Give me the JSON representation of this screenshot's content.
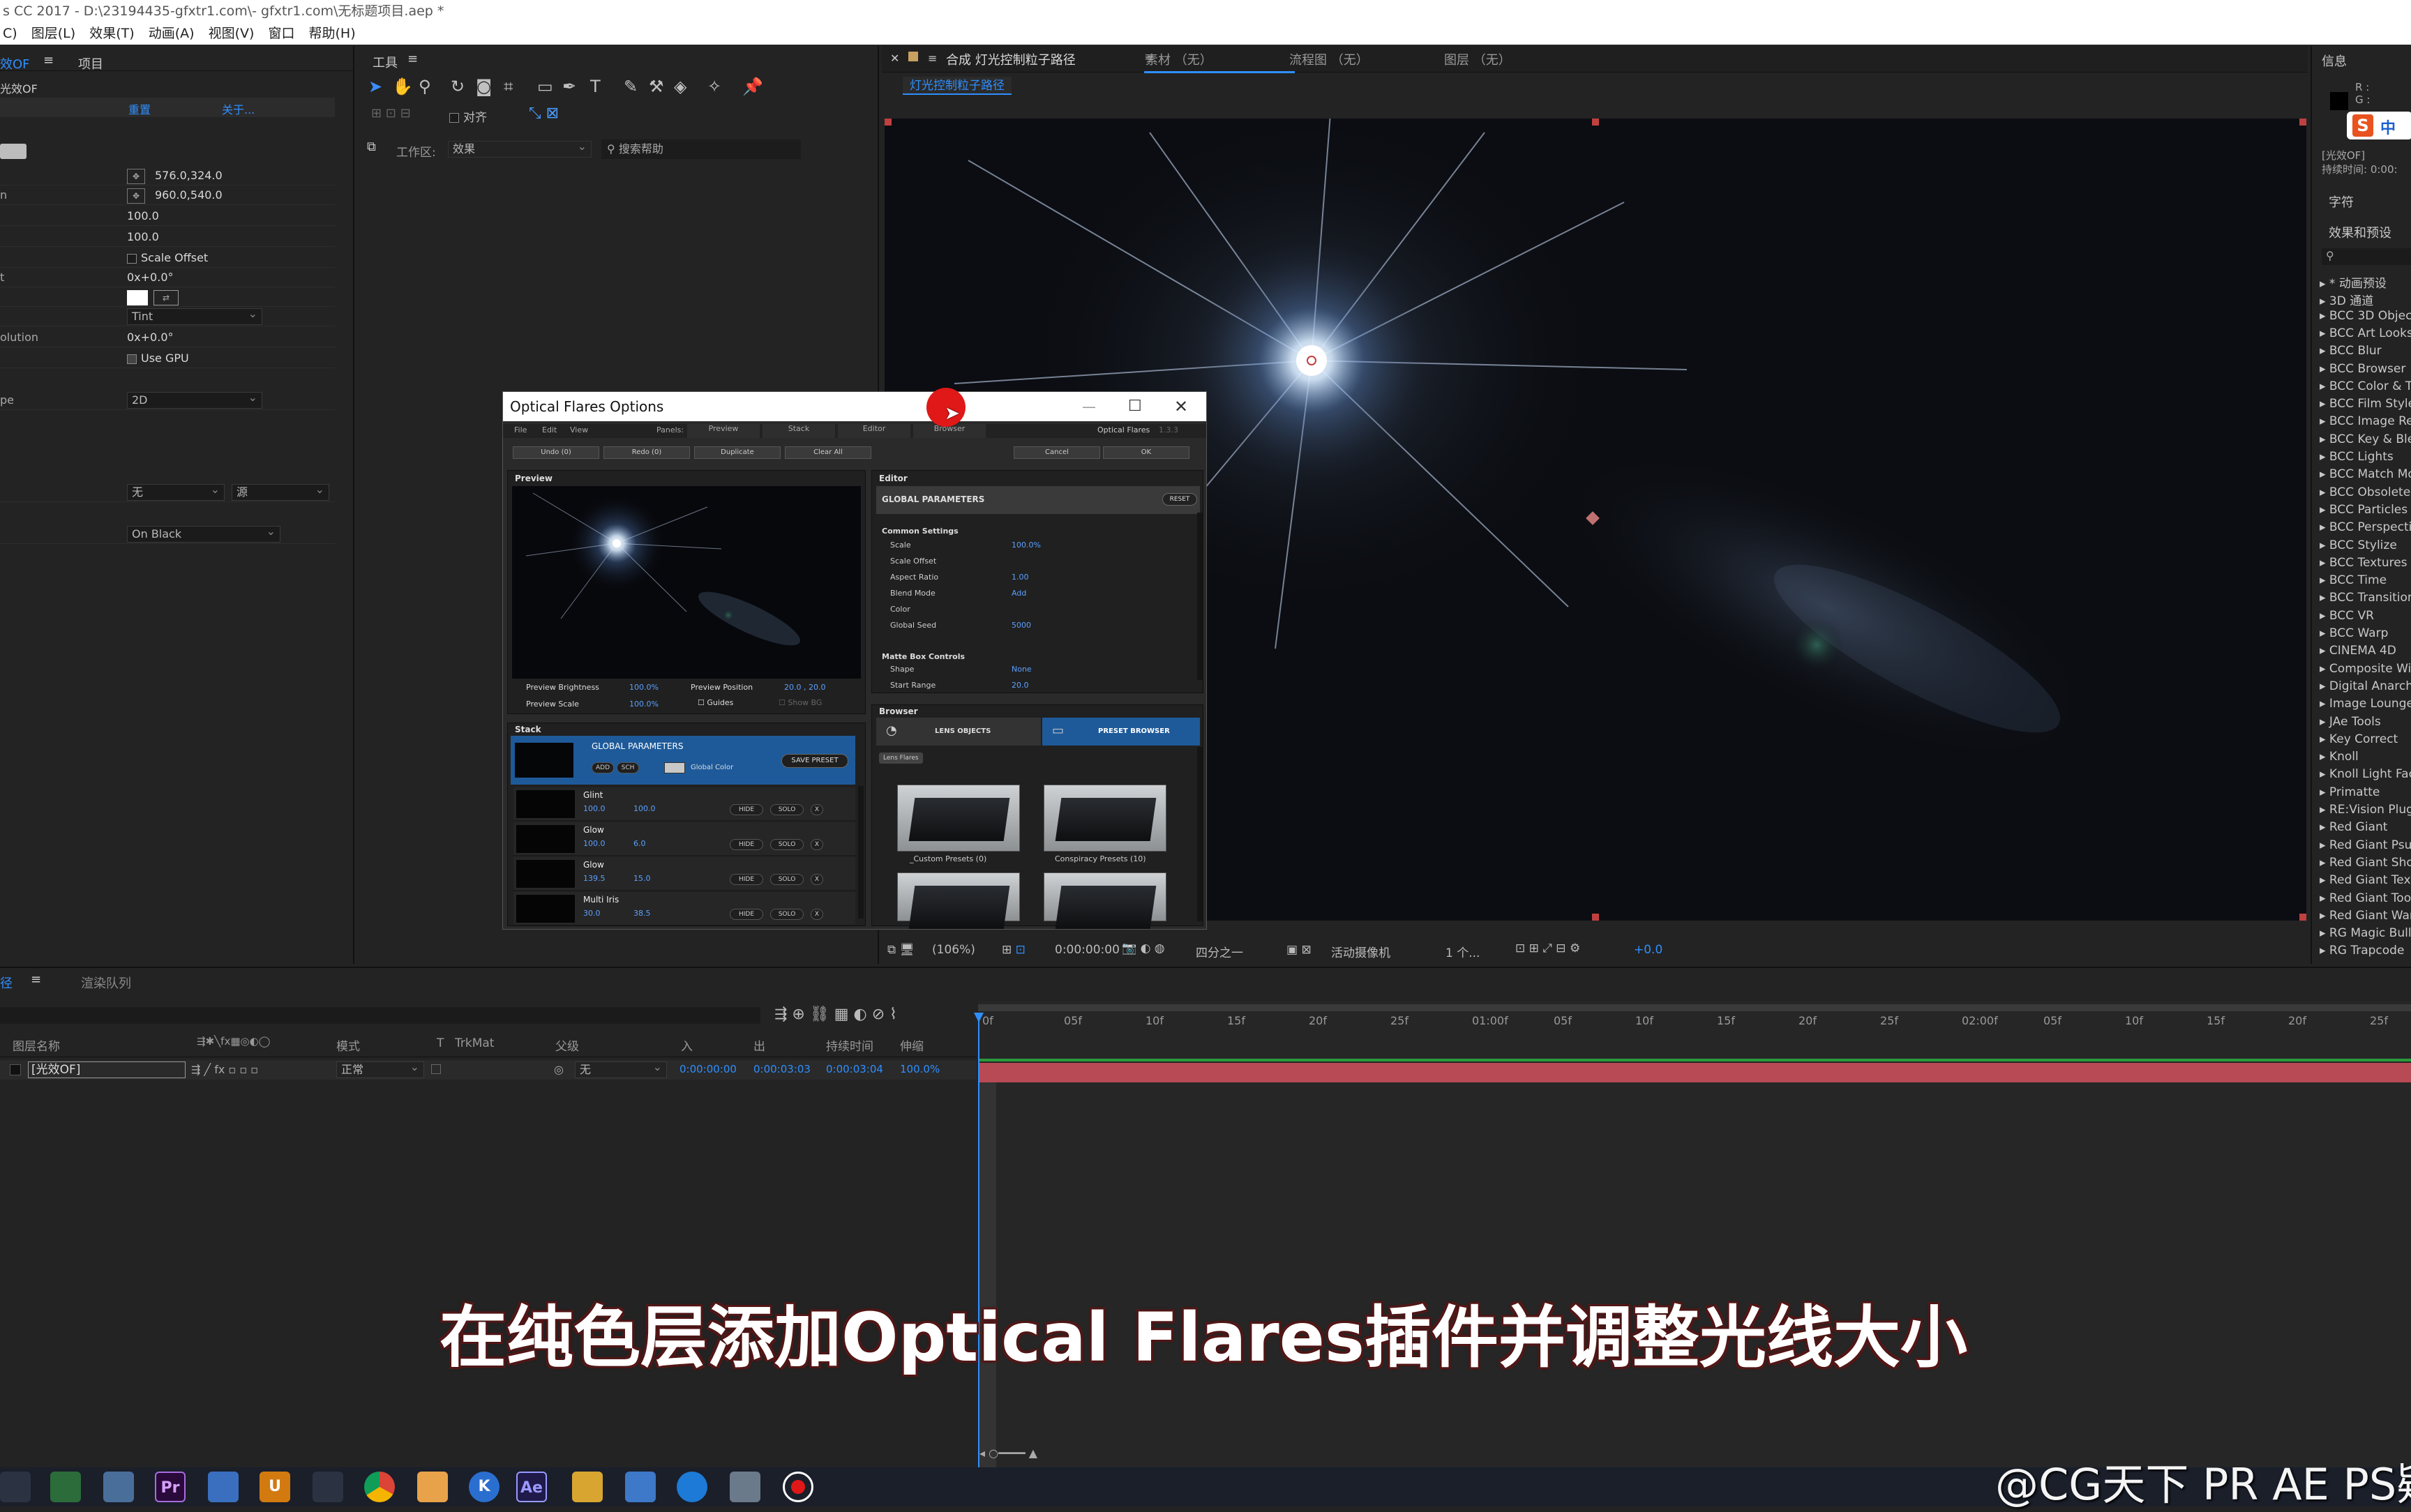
{
  "window": {
    "title": "s CC 2017 - D:\\23194435-gfxtr1.com\\- gfxtr1.com\\无标题项目.aep *"
  },
  "menu": [
    "C)",
    "图层(L)",
    "效果(T)",
    "动画(A)",
    "视图(V)",
    "窗口",
    "帮助(H)"
  ],
  "effect_controls": {
    "tab": "效OF",
    "tab2": "项目",
    "layer": "光效OF",
    "reset": "重置",
    "about": "关于...",
    "rows": [
      {
        "label": "",
        "value": "576.0,324.0"
      },
      {
        "label": "n",
        "value": "960.0,540.0"
      },
      {
        "label": "",
        "value": "100.0"
      },
      {
        "label": "",
        "value": "100.0"
      },
      {
        "label": "",
        "value": "Scale Offset"
      },
      {
        "label": "t",
        "value": "0x+0.0°"
      },
      {
        "label": "",
        "value": "Tint"
      },
      {
        "label": "olution",
        "value": "0x+0.0°"
      },
      {
        "label": "",
        "value": "Use GPU"
      },
      {
        "label": "pe",
        "value": "2D"
      },
      {
        "label": "",
        "value": "无"
      },
      {
        "label": "",
        "value": "源"
      },
      {
        "label": "",
        "value": "On Black"
      }
    ]
  },
  "tools": {
    "title": "工具",
    "align": "对齐",
    "workspace_label": "工作区:",
    "workspace": "效果",
    "search_placeholder": "搜索帮助"
  },
  "viewer": {
    "tabs": [
      "合成 灯光控制粒子路径",
      "素材 （无）",
      "流程图 （无）",
      "图层 （无）"
    ],
    "comp_tab": "灯光控制粒子路径",
    "zoom": "(106%)",
    "timecode": "0:00:00:00",
    "resolution": "四分之一",
    "camera": "活动摄像机",
    "views": "1 个...",
    "exposure": "+0.0"
  },
  "dialog": {
    "title": "Optical Flares Options",
    "menu": [
      "File",
      "Edit",
      "View"
    ],
    "panels_label": "Panels:",
    "panel_tabs": [
      "Preview",
      "Stack",
      "Editor",
      "Browser"
    ],
    "brand": "Optical Flares",
    "version": "1.3.3",
    "buttons": [
      "Undo (0)",
      "Redo (0)",
      "Duplicate",
      "Clear All"
    ],
    "cancel": "Cancel",
    "ok": "OK",
    "preview": {
      "title": "Preview",
      "brightness_label": "Preview Brightness",
      "brightness": "100.0%",
      "position_label": "Preview Position",
      "position": "20.0 , 20.0",
      "scale_label": "Preview Scale",
      "scale": "100.0%",
      "guides": "Guides",
      "show_bg": "Show BG"
    },
    "editor": {
      "title": "Editor",
      "section": "GLOBAL PARAMETERS",
      "reset": "RESET",
      "common": "Common Settings",
      "rows": [
        {
          "label": "Scale",
          "value": "100.0%"
        },
        {
          "label": "Scale Offset",
          "value": ""
        },
        {
          "label": "Aspect Ratio",
          "value": "1.00"
        },
        {
          "label": "Blend Mode",
          "value": "Add"
        },
        {
          "label": "Color",
          "value": ""
        },
        {
          "label": "Global Seed",
          "value": "5000"
        }
      ],
      "matte": "Matte Box Controls",
      "matte_rows": [
        {
          "label": "Shape",
          "value": "None"
        },
        {
          "label": "Start Range",
          "value": "20.0"
        }
      ]
    },
    "stack": {
      "title": "Stack",
      "global": "GLOBAL PARAMETERS",
      "add": "ADD",
      "sch": "SCH",
      "global_color": "Global Color",
      "save_preset": "SAVE PRESET",
      "hide": "HIDE",
      "solo": "SOLO",
      "close": "X",
      "items": [
        {
          "name": "Glint",
          "v1": "100.0",
          "v2": "100.0"
        },
        {
          "name": "Glow",
          "v1": "100.0",
          "v2": "6.0"
        },
        {
          "name": "Glow",
          "v1": "139.5",
          "v2": "15.0"
        },
        {
          "name": "Multi Iris",
          "v1": "30.0",
          "v2": "38.5"
        }
      ]
    },
    "browser": {
      "title": "Browser",
      "lens_objects": "LENS OBJECTS",
      "preset_browser": "PRESET BROWSER",
      "crumb": "Lens Flares",
      "folders": [
        "_Custom Presets (0)",
        "Conspiracy Presets (10)",
        "",
        ""
      ]
    }
  },
  "info": {
    "title": "信息",
    "r": "R :",
    "g": "G :",
    "layer": "[光效OF]",
    "duration": "持续时间: 0:00:",
    "ime": "中"
  },
  "char_title": "字符",
  "effects_presets": {
    "title": "效果和预设",
    "items": [
      "* 动画预设",
      "3D 通道",
      "BCC 3D Objects",
      "BCC Art Looks",
      "BCC Blur",
      "BCC Browser",
      "BCC Color & To",
      "BCC Film Style",
      "BCC Image Rest",
      "BCC Key & Blend",
      "BCC Lights",
      "BCC Match Move",
      "BCC Obsolete",
      "BCC Particles",
      "BCC Perspective",
      "BCC Stylize",
      "BCC Textures",
      "BCC Time",
      "BCC Transitions",
      "BCC VR",
      "BCC Warp",
      "CINEMA 4D",
      "Composite Wiza",
      "Digital Anarchy",
      "Image Lounge",
      "JAe Tools",
      "Key Correct",
      "Knoll",
      "Knoll Light Facto",
      "Primatte",
      "RE:Vision Plug-i",
      "Red Giant",
      "Red Giant Psuna",
      "Red Giant Shoo",
      "Red Giant Text A",
      "Red Giant Toon",
      "Red Giant Warp",
      "RG Magic Bullet",
      "RG Trapcode"
    ]
  },
  "timeline": {
    "tab": "径",
    "tab2": "渲染队列",
    "cols": [
      "图层名称",
      "模式",
      "T",
      "TrkMat",
      "父级",
      "入",
      "出",
      "持续时间",
      "伸缩"
    ],
    "layer": {
      "name": "[光效OF]",
      "mode": "正常",
      "parent": "无",
      "in": "0:00:00:00",
      "out": "0:00:03:03",
      "duration": "0:00:03:04",
      "stretch": "100.0%"
    },
    "ruler": [
      "0f",
      "05f",
      "10f",
      "15f",
      "20f",
      "25f",
      "01:00f",
      "05f",
      "10f",
      "15f",
      "20f",
      "25f",
      "02:00f",
      "05f",
      "10f",
      "15f",
      "20f",
      "25f"
    ]
  },
  "subtitle": "在纯色层添加Optical Flares插件并调整光线大小",
  "watermark": "@CG天下 PR AE PS疑",
  "taskbar": {
    "icons": [
      "",
      "",
      "",
      "Pr",
      "",
      "U",
      "",
      "",
      "",
      "K",
      "Ae",
      "",
      "",
      "",
      "",
      ""
    ]
  },
  "colors": {
    "accent": "#2f8fff",
    "ae": "#9999ff",
    "pr": "#9999ff",
    "subtitle_outline": "#5a1818"
  }
}
